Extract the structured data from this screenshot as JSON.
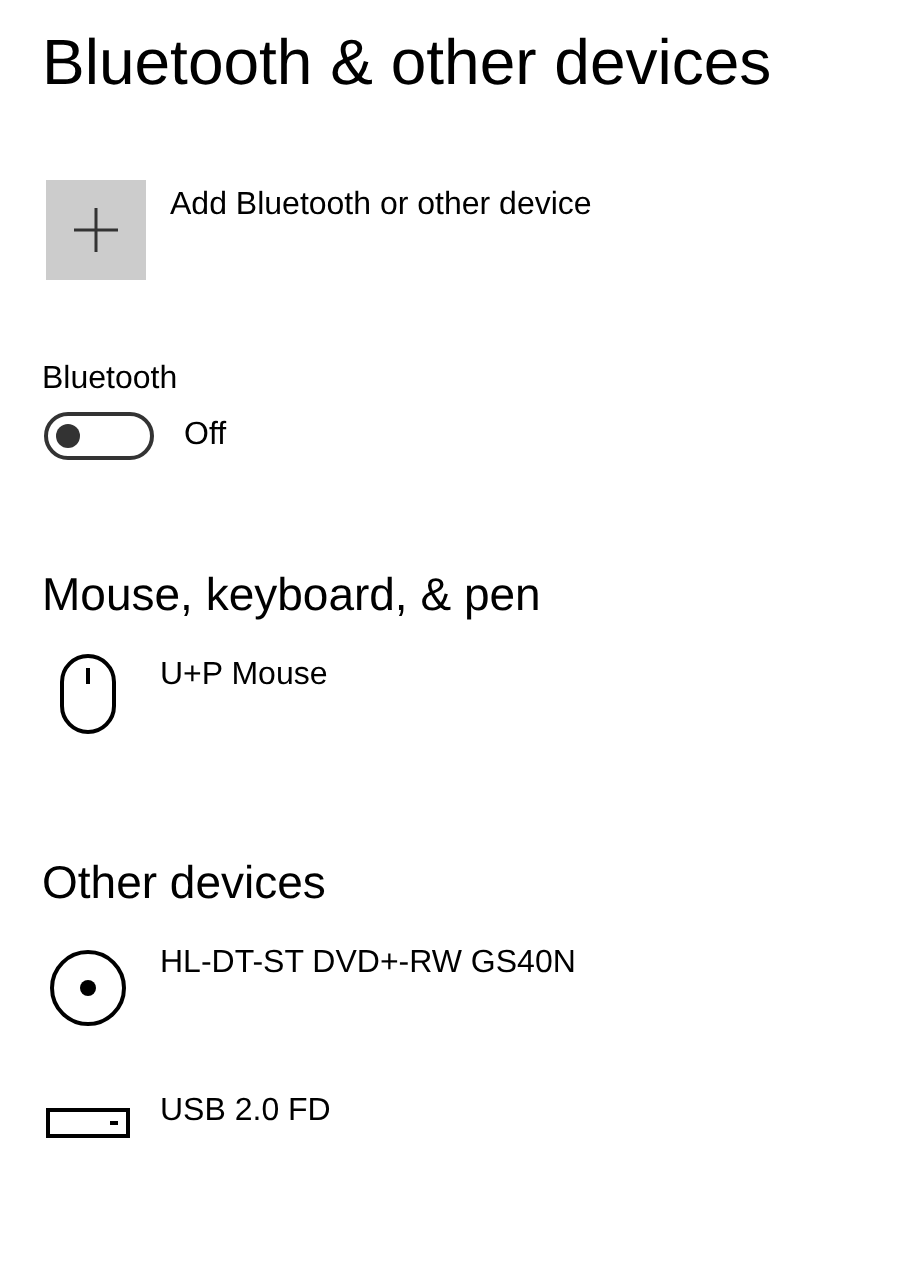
{
  "title": "Bluetooth & other devices",
  "add_device": {
    "label": "Add Bluetooth or other device"
  },
  "bluetooth": {
    "label": "Bluetooth",
    "on": false,
    "state_text": "Off"
  },
  "sections": [
    {
      "heading": "Mouse, keyboard, & pen",
      "devices": [
        {
          "kind": "mouse",
          "name": "U+P Mouse"
        }
      ]
    },
    {
      "heading": "Other devices",
      "devices": [
        {
          "kind": "disc",
          "name": "HL-DT-ST DVD+-RW GS40N"
        },
        {
          "kind": "drive",
          "name": "USB 2.0 FD"
        }
      ]
    }
  ]
}
